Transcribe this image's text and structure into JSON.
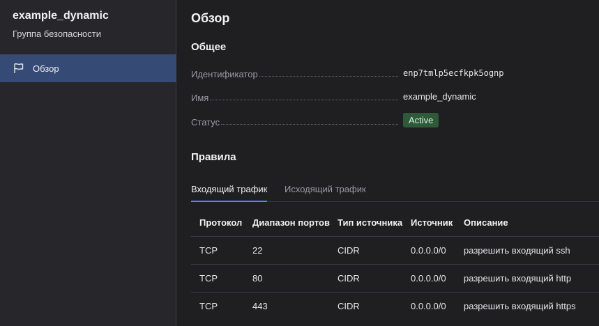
{
  "sidebar": {
    "title": "example_dynamic",
    "subtitle": "Группа безопасности",
    "items": [
      {
        "label": "Обзор",
        "icon": "flag-icon",
        "active": true
      }
    ]
  },
  "main": {
    "title": "Обзор",
    "general": {
      "heading": "Общее",
      "props": {
        "id_label": "Идентификатор",
        "id_value": "enp7tmlp5ecfkpk5ognp",
        "name_label": "Имя",
        "name_value": "example_dynamic",
        "status_label": "Статус",
        "status_value": "Active"
      }
    },
    "rules": {
      "heading": "Правила",
      "tabs": [
        {
          "label": "Входящий трафик",
          "active": true
        },
        {
          "label": "Исходящий трафик",
          "active": false
        }
      ],
      "columns": [
        "Протокол",
        "Диапазон портов",
        "Тип источника",
        "Источник",
        "Описание"
      ],
      "rows": [
        [
          "TCP",
          "22",
          "CIDR",
          "0.0.0.0/0",
          "разрешить входящий ssh"
        ],
        [
          "TCP",
          "80",
          "CIDR",
          "0.0.0.0/0",
          "разрешить входящий http"
        ],
        [
          "TCP",
          "443",
          "CIDR",
          "0.0.0.0/0",
          "разрешить входящий https"
        ]
      ]
    }
  },
  "colors": {
    "accent": "#5282ff",
    "sidebar_active": "#354a74",
    "status_active_bg": "#2f5a3a"
  }
}
